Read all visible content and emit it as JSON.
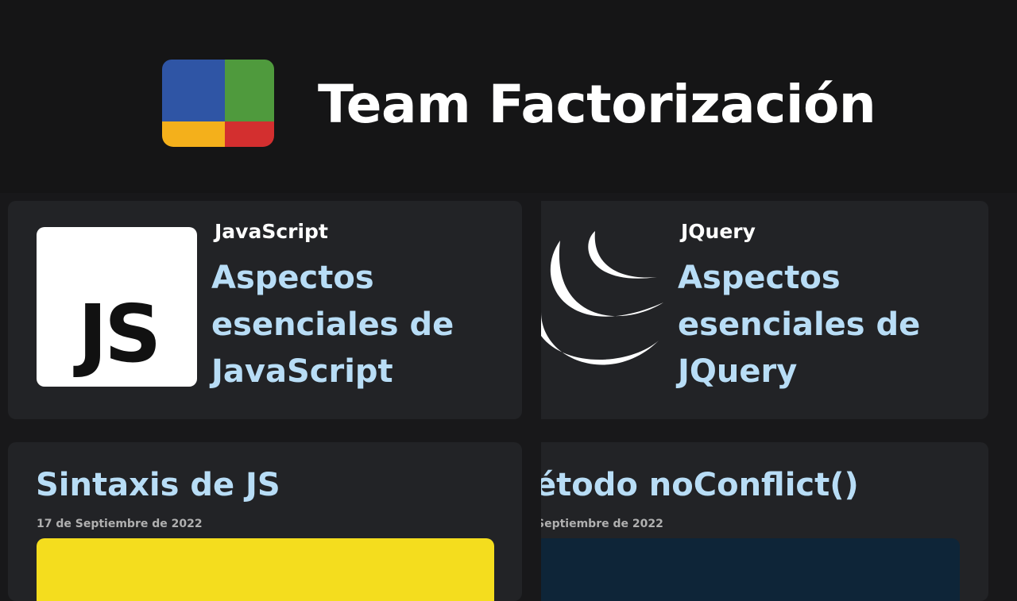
{
  "site": {
    "title": "Team Factorización"
  },
  "colors": {
    "logo_blue": "#2f55a5",
    "logo_green": "#4f9a3d",
    "logo_yellow": "#f4b01b",
    "logo_red": "#d32f2f",
    "title_accent": "#b8ddf6",
    "js_banner": "#f4dd1e",
    "jquery_banner": "#0e2538"
  },
  "featured": [
    {
      "category": "JavaScript",
      "title": "Aspectos esenciales de JavaScript",
      "thumbnail_icon": "js-logo-icon",
      "thumbnail_text": "JS"
    },
    {
      "category": "JQuery",
      "title": "Aspectos esenciales de JQuery",
      "thumbnail_icon": "jquery-logo-icon"
    }
  ],
  "posts": [
    {
      "title": "Sintaxis de JS",
      "date": "17 de Septiembre de 2022"
    },
    {
      "title": "étodo noConflict()",
      "date": "Septiembre de 2022"
    }
  ]
}
